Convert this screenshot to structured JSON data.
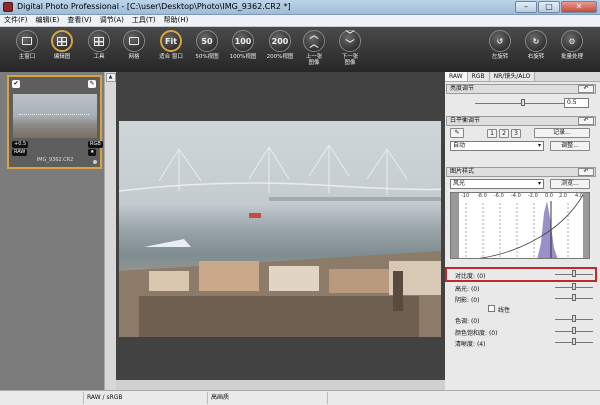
{
  "window": {
    "title": "Digital Photo Professional - [C:\\user\\Desktop\\Photo\\IMG_9362.CR2 *]",
    "buttons": {
      "minimize": "–",
      "maximize": "□",
      "close": "✕"
    }
  },
  "menubar": {
    "items": [
      "文件(F)",
      "编辑(E)",
      "查看(V)",
      "调节(A)",
      "工具(T)",
      "帮助(H)"
    ]
  },
  "toolbar": {
    "buttons": [
      {
        "label": "主窗口",
        "icon": "main-window-icon"
      },
      {
        "label": "编辑图",
        "icon": "edit-image-icon"
      },
      {
        "label": "工具",
        "icon": "tools-icon"
      },
      {
        "label": "网格",
        "icon": "grid-icon"
      },
      {
        "label": "适合\n窗口",
        "icon": "fit-window-icon"
      },
      {
        "label": "50%视图",
        "icon": "zoom-50-icon",
        "glyph": "50"
      },
      {
        "label": "100%视图",
        "icon": "zoom-100-icon",
        "glyph": "100"
      },
      {
        "label": "200%视图",
        "icon": "zoom-200-icon",
        "glyph": "200"
      },
      {
        "label": "上一张\n图像",
        "icon": "prev-image-icon"
      },
      {
        "label": "下一张\n图像",
        "icon": "next-image-icon"
      },
      {
        "label": "左旋转",
        "icon": "rotate-left-icon"
      },
      {
        "label": "右旋转",
        "icon": "rotate-right-icon"
      },
      {
        "label": "批量处理",
        "icon": "batch-process-icon"
      }
    ],
    "fit_glyph": "Fit",
    "rot_left_glyph": "↺",
    "rot_right_glyph": "↻",
    "batch_glyph": "⚙"
  },
  "thumbnail": {
    "filename": "IMG_9362.CR2",
    "rating_badge": "+0.5",
    "raw_badge": "RAW",
    "rgb_badge": "RGB",
    "check_icon": "✔",
    "edit_icon": "✎",
    "star_icon": "★"
  },
  "panel": {
    "tabs": [
      "RAW",
      "RGB",
      "NR/镜头/ALO"
    ],
    "brightness": {
      "header": "亮度调节",
      "value": "0.5"
    },
    "white_balance": {
      "header": "白平衡调节",
      "eyedropper": "✎",
      "presets": [
        "1",
        "2",
        "3"
      ],
      "record_button": "记录...",
      "mode": "自动",
      "adjust_button": "调整..."
    },
    "picture_style": {
      "header": "图片样式",
      "style": "风光",
      "browse_button": "浏览...",
      "hist_ticks": [
        "-10",
        "-8.0",
        "-6.0",
        "-4.0",
        "-2.0",
        "0.0",
        "2.0",
        "4.0"
      ],
      "params": [
        {
          "label": "对比度",
          "value": "(0)"
        },
        {
          "label": "高光",
          "value": "(0)"
        },
        {
          "label": "阴影",
          "value": "(0)"
        },
        {
          "label": "色调",
          "value": "(0)"
        },
        {
          "label": "颜色饱和度",
          "value": "(0)"
        },
        {
          "label": "清晰度",
          "value": "(4)"
        }
      ],
      "linear_label": "线性"
    }
  },
  "status": {
    "cells": [
      "",
      "RAW / sRGB",
      "高画质"
    ]
  }
}
